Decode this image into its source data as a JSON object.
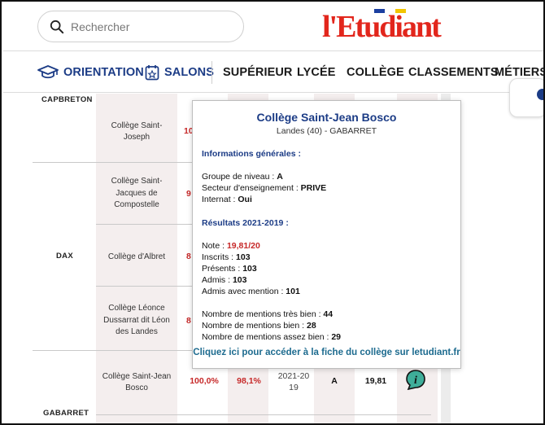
{
  "header": {
    "search_placeholder": "Rechercher",
    "logo_text": "l'Etudiant"
  },
  "nav": {
    "items": [
      "ORIENTATION",
      "SALONS",
      "SUPÉRIEUR",
      "LYCÉE",
      "COLLÈGE",
      "CLASSEMENTS",
      "MÉTIERS"
    ]
  },
  "table": {
    "cities": [
      "CAPBRETON",
      "DAX",
      "GABARRET"
    ],
    "schools": [
      "Collège Saint-Joseph",
      "Collège Saint-Jacques de Compostelle",
      "Collège d'Albret",
      "Collège Léonce Dussarrat dit Léon des Landes",
      "Collège Saint-Jean Bosco"
    ],
    "partial_values": [
      "10",
      "9",
      "8",
      "8"
    ],
    "last_row": {
      "rate1": "100,0%",
      "rate2": "98,1%",
      "years": "2021-20 19",
      "level": "A",
      "note": "19,81"
    }
  },
  "popup": {
    "title": "Collège Saint-Jean Bosco",
    "subtitle": "Landes (40) - GABARRET",
    "section_general": "Informations générales :",
    "groupe_label": "Groupe de niveau : ",
    "groupe_value": "A",
    "secteur_label": "Secteur d'enseignement : ",
    "secteur_value": "PRIVE",
    "internat_label": "Internat : ",
    "internat_value": "Oui",
    "section_results": "Résultats 2021-2019 :",
    "note_label": "Note : ",
    "note_value": "19,81/20",
    "inscrits_label": "Inscrits : ",
    "inscrits_value": "103",
    "presents_label": "Présents : ",
    "presents_value": "103",
    "admis_label": "Admis : ",
    "admis_value": "103",
    "admis_mention_label": "Admis avec mention : ",
    "admis_mention_value": "101",
    "tres_bien_label": "Nombre de mentions très bien : ",
    "tres_bien_value": "44",
    "bien_label": "Nombre de mentions bien : ",
    "bien_value": "28",
    "assez_bien_label": "Nombre de mentions assez bien : ",
    "assez_bien_value": "29",
    "link": "Cliquez ici pour accéder à la fiche du collège sur letudiant.fr"
  },
  "colors": {
    "accent_blue": "#1c3c86",
    "red": "#c62828",
    "logo_red": "#e2261c",
    "column_shade": "#f4eeee"
  }
}
